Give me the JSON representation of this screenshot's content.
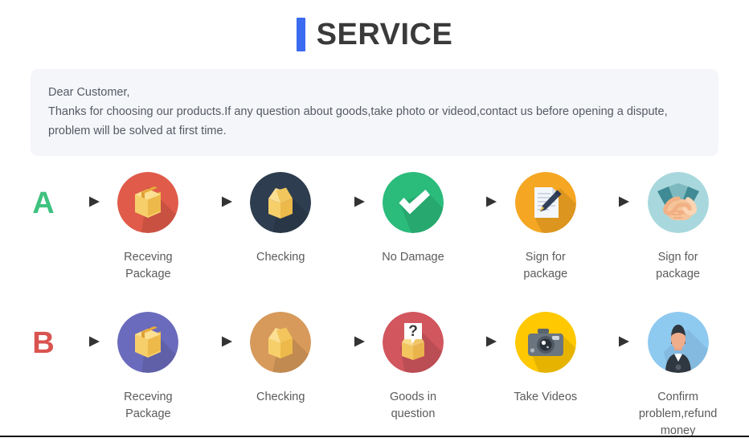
{
  "header": {
    "accent_color": "#3b6bf0",
    "title": "SERVICE"
  },
  "notice": {
    "line1": "Dear Customer,",
    "line2": "Thanks for choosing our products.If any question about goods,take photo or videod,contact us before opening a dispute,",
    "line3": "problem will be solved at first time.",
    "background_color": "#f5f6fa",
    "text_color": "#555a63"
  },
  "flows": [
    {
      "badge": "A",
      "badge_color": "#3ec27f",
      "steps": [
        {
          "label": "Receving Package",
          "icon": "closed-box-icon",
          "circle_color": "#e05b4a"
        },
        {
          "label": "Checking",
          "icon": "open-box-icon",
          "circle_color": "#2e3d4f"
        },
        {
          "label": "No Damage",
          "icon": "check-mark-icon",
          "circle_color": "#2bbb7b"
        },
        {
          "label": "Sign for package",
          "icon": "document-pen-icon",
          "circle_color": "#f5a623"
        },
        {
          "label": "Sign for package",
          "icon": "handshake-icon",
          "circle_color": "#a8d8dd"
        }
      ]
    },
    {
      "badge": "B",
      "badge_color": "#d9534f",
      "steps": [
        {
          "label": "Receving Package",
          "icon": "closed-box-icon",
          "circle_color": "#6b6bbd"
        },
        {
          "label": "Checking",
          "icon": "open-box-icon",
          "circle_color": "#d79a5b"
        },
        {
          "label": "Goods in question",
          "icon": "question-box-icon",
          "circle_color": "#d1565e"
        },
        {
          "label": "Take Videos",
          "icon": "camera-icon",
          "circle_color": "#ffc800"
        },
        {
          "label": "Confirm problem,refund money",
          "icon": "support-person-icon",
          "circle_color": "#8ec9f0"
        }
      ]
    }
  ],
  "arrow": {
    "name": "right-arrow-icon",
    "color": "#3f3f3f"
  }
}
